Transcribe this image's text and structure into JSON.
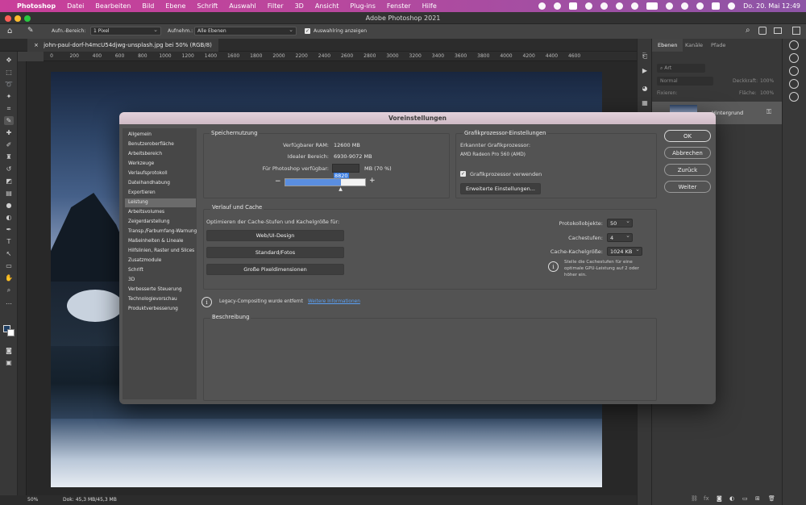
{
  "menubar": {
    "apple": "",
    "items": [
      "Photoshop",
      "Datei",
      "Bearbeiten",
      "Bild",
      "Ebene",
      "Schrift",
      "Auswahl",
      "Filter",
      "3D",
      "Ansicht",
      "Plug-ins",
      "Fenster",
      "Hilfe"
    ],
    "datetime": "Do. 20. Mai  12:49"
  },
  "window": {
    "title": "Adobe Photoshop 2021"
  },
  "options_bar": {
    "sample_size_label": "Aufn.-Bereich:",
    "sample_size_value": "1 Pixel",
    "sample_label": "Aufnehm.:",
    "sample_value": "Alle Ebenen",
    "ring_label": "Auswahlring anzeigen"
  },
  "document": {
    "tab_title": "john-paul-dorf-h4mcU54djwg-unsplash.jpg bei 50% (RGB/8)",
    "ruler_ticks": [
      "0",
      "200",
      "400",
      "600",
      "800",
      "1000",
      "1200",
      "1400",
      "1600",
      "1800",
      "2000",
      "2200",
      "2400",
      "2600",
      "2800",
      "3000",
      "3200",
      "3400",
      "3600",
      "3800",
      "4000",
      "4200",
      "4400",
      "4600"
    ],
    "zoom": "50%",
    "doc_info": "Dok: 45,3 MB/45,3 MB"
  },
  "panels": {
    "tabs": [
      "Ebenen",
      "Kanäle",
      "Pfade"
    ],
    "filter_placeholder": "Art",
    "blend_mode": "Normal",
    "opacity_label": "Deckkraft:",
    "opacity_value": "100%",
    "lock_label": "Fixieren:",
    "fill_label": "Fläche:",
    "fill_value": "100%",
    "layer_name": "Hintergrund"
  },
  "dialog": {
    "title": "Voreinstellungen",
    "nav": [
      "Allgemein",
      "Benutzeroberfläche",
      "Arbeitsbereich",
      "Werkzeuge",
      "Verlaufsprotokoll",
      "Dateihandhabung",
      "Exportieren",
      "Leistung",
      "Arbeitsvolumes",
      "Zeigerdarstellung",
      "Transp./Farbumfang-Warnung",
      "Maßeinheiten & Lineale",
      "Hilfslinien, Raster und Slices",
      "Zusatzmodule",
      "Schrift",
      "3D",
      "Verbesserte Steuerung",
      "Technologievorschau",
      "Produktverbesserung"
    ],
    "nav_selected_index": 7,
    "memory": {
      "heading": "Speichernutzung",
      "available_label": "Verfügbarer RAM:",
      "available_value": "12600 MB",
      "ideal_label": "Idealer Bereich:",
      "ideal_value": "6930-9072 MB",
      "ps_label": "Für Photoshop verfügbar:",
      "ps_value": "8820",
      "ps_unit": "MB (70 %)",
      "slider_fraction": 0.7,
      "minus": "−",
      "plus": "+"
    },
    "gpu": {
      "heading": "Grafikprozessor-Einstellungen",
      "detected_label": "Erkannter Grafikprozessor:",
      "detected_value": "AMD Radeon Pro 560 (AMD)",
      "use_label": "Grafikprozessor verwenden",
      "use_checked": true,
      "advanced_button": "Erweiterte Einstellungen..."
    },
    "cache": {
      "heading": "Verlauf und Cache",
      "optimize_label": "Optimieren der Cache-Stufen und Kachelgröße für:",
      "buttons": [
        "Web/UI-Design",
        "Standard/Fotos",
        "Große Pixeldimensionen"
      ],
      "history_label": "Protokollobjekte:",
      "history_value": "50",
      "levels_label": "Cachestufen:",
      "levels_value": "4",
      "tile_label": "Cache-Kachelgröße:",
      "tile_value": "1024 KB",
      "hint": [
        "Stelle die Cachestufen für eine",
        "optimale GPU-Leistung auf 2 oder",
        "höher ein."
      ]
    },
    "legacy": {
      "text": "Legacy-Compositing wurde entfernt",
      "link": "Weitere Informationen"
    },
    "description": {
      "heading": "Beschreibung"
    },
    "buttons": {
      "ok": "OK",
      "cancel": "Abbrechen",
      "back": "Zurück",
      "next": "Weiter"
    },
    "info_glyph": "i"
  }
}
